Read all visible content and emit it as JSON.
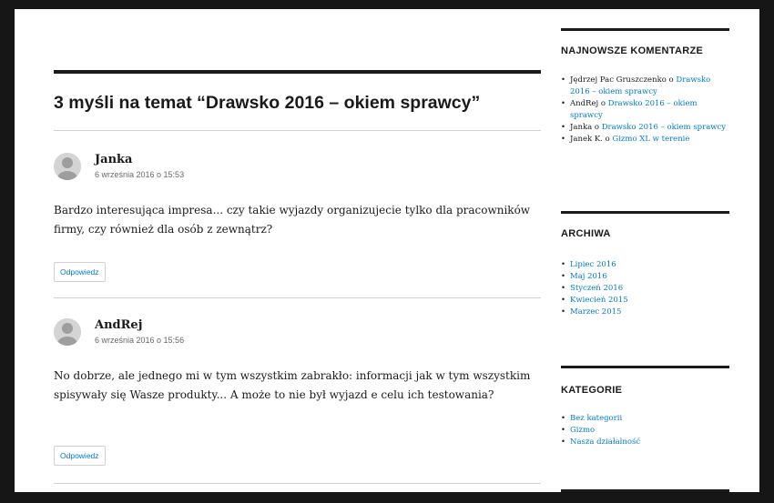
{
  "comments_section": {
    "title": "3 myśli na temat “Drawsko 2016 – okiem sprawcy”",
    "reply_label": "Odpowiedz",
    "items": [
      {
        "author": "Janka",
        "date": "6 września 2016 o 15:53",
        "text": "Bardzo interesująca impresa... czy takie wyjazdy organizujecie tylko dla pracowników firmy, czy również dla osób z zewnątrz?"
      },
      {
        "author": "AndRej",
        "date": "6 września 2016 o 15:56",
        "text": "No dobrze, ale jednego mi w tym wszystkim zabrakło: informacji jak w tym wszystkim spisywały się Wasze produkty... A może to nie był wyjazd e celu ich testowania?"
      }
    ]
  },
  "sidebar": {
    "recent_comments": {
      "title": "NAJNOWSZE KOMENTARZE",
      "items": [
        {
          "author": "Jędrzej Pac Gruszczenko",
          "connector": " o ",
          "post": "Drawsko 2016 – okiem sprawcy"
        },
        {
          "author": "AndRej",
          "connector": " o ",
          "post": "Drawsko 2016 – okiem sprawcy"
        },
        {
          "author": "Janka",
          "connector": " o ",
          "post": "Drawsko 2016 – okiem sprawcy"
        },
        {
          "author": "Janek K.",
          "connector": " o ",
          "post": "Gizmo XL w terenie"
        }
      ]
    },
    "archives": {
      "title": "ARCHIWA",
      "items": [
        "Lipiec 2016",
        "Maj 2016",
        "Styczeń 2016",
        "Kwiecień 2015",
        "Marzec 2015"
      ]
    },
    "categories": {
      "title": "KATEGORIE",
      "items": [
        "Bez kategorii",
        "Gizmo",
        "Nasza działalność"
      ]
    }
  },
  "colors": {
    "link": "#007acc",
    "text": "#1a1a1a",
    "meta": "#686868",
    "frame": "#161616"
  },
  "icons": {
    "avatar": "default-avatar-icon"
  }
}
